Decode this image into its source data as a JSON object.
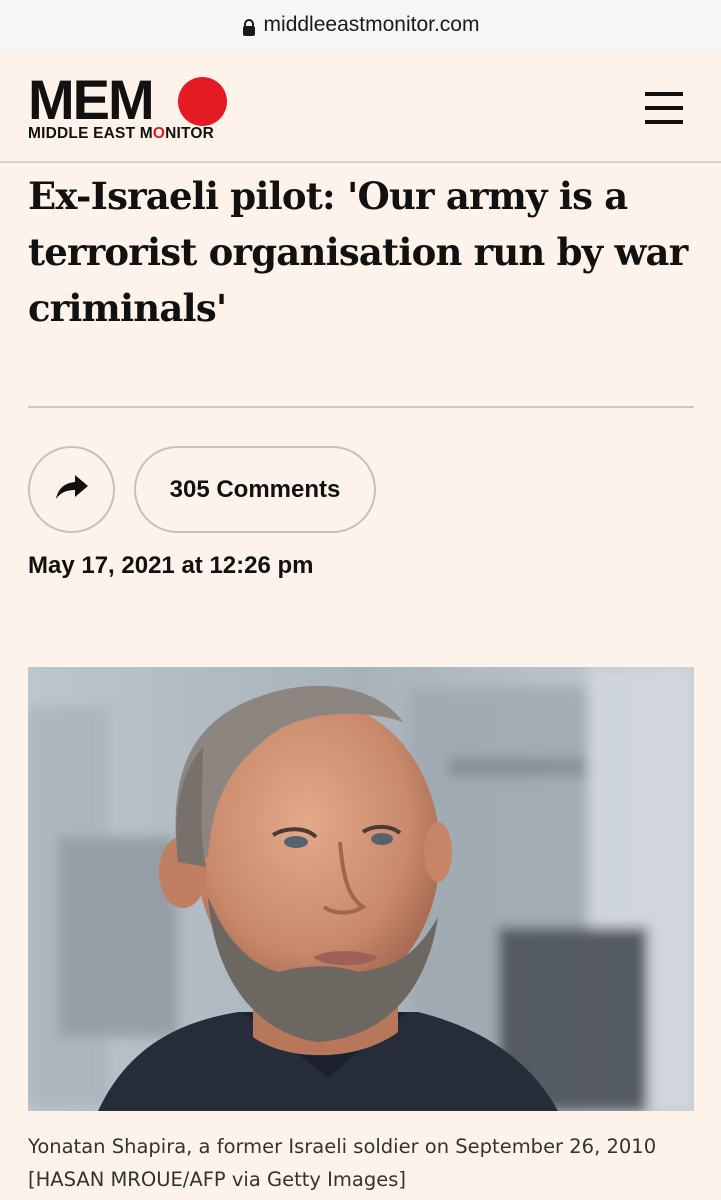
{
  "browser": {
    "url": "middleeastmonitor.com",
    "lock_icon": "lock-icon"
  },
  "header": {
    "logo_word": "MEM",
    "logo_sub_before": "MIDDLE EAST M",
    "logo_sub_o": "O",
    "logo_sub_after": "NITOR",
    "brand_color": "#e41b23",
    "menu_icon": "hamburger-menu-icon"
  },
  "article": {
    "title": "Ex-Israeli pilot: 'Our army is a terrorist organisation run by war criminals'",
    "share_icon": "share-arrow-icon",
    "comments_label": "305 Comments",
    "date": "May 17, 2021 at 12:26 pm",
    "caption_line1": "Yonatan Shapira, a former Israeli soldier on September 26, 2010",
    "caption_line2": "[HASAN MROUE/AFP via Getty Images]"
  }
}
